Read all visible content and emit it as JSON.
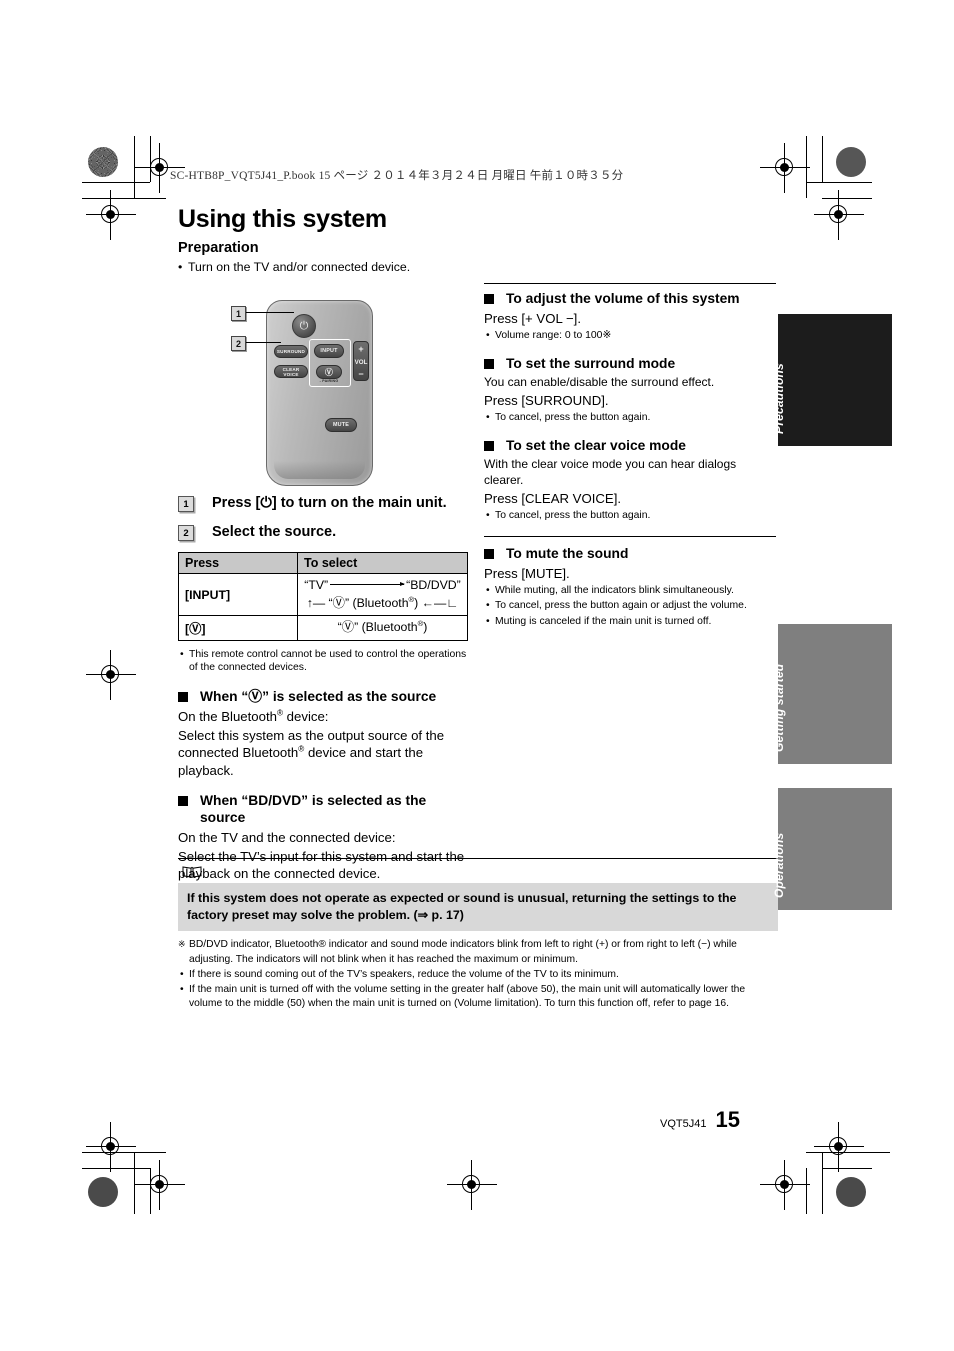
{
  "header": {
    "book_line": "SC-HTB8P_VQT5J41_P.book   15 ページ   ２０１４年３月２４日   月曜日   午前１０時３５分"
  },
  "page": {
    "title": "Using this system",
    "subtitle": "Preparation",
    "prep_bullet": "Turn on the TV and/or connected device."
  },
  "remote": {
    "callout_1": "1",
    "callout_2": "2",
    "buttons": {
      "power": "power-symbol",
      "surround": "SURROUND",
      "clear_voice": "CLEAR VOICE",
      "input": "INPUT",
      "bluetooth": "bluetooth-symbol",
      "pairing": "- PAIRING",
      "vol_plus": "+",
      "vol_label": "VOL",
      "vol_minus": "−",
      "mute": "MUTE"
    }
  },
  "steps": [
    {
      "num": "1",
      "text": "Press [⏻] to turn on the main unit."
    },
    {
      "num": "2",
      "text": "Select the source."
    }
  ],
  "source_table": {
    "headers": [
      "Press",
      "To select"
    ],
    "rows": [
      {
        "press": "[INPUT]",
        "select_line1": "“TV” ⟶ “BD/DVD”",
        "select_line2": "↑— “ Ⓑ ” (Bluetooth®) ←—┘"
      },
      {
        "press": "[ Ⓑ ]",
        "select_line1": "“ Ⓑ ” (Bluetooth®)",
        "select_line2": ""
      }
    ]
  },
  "left_column": {
    "remote_note": "This remote control cannot be used to control the operations of the connected devices.",
    "bt_section": {
      "heading_pre": "When “",
      "heading_post": "” is selected as the source",
      "line1": "On the Bluetooth® device:",
      "line2": "Select this system as the output source of the connected Bluetooth® device and start the playback."
    },
    "bd_section": {
      "heading": "When “BD/DVD” is selected as the source",
      "line1": "On the TV and the connected device:",
      "line2": "Select the TV’s input for this system and start the playback on the connected device."
    }
  },
  "right_column": {
    "volume": {
      "heading": "To adjust the volume of this system",
      "press": "Press [+ VOL −].",
      "note": "Volume range: 0 to 100※"
    },
    "surround": {
      "heading": "To set the surround mode",
      "desc": "You can enable/disable the surround effect.",
      "press": "Press [SURROUND].",
      "note": "To cancel, press the button again."
    },
    "clear_voice": {
      "heading": "To set the clear voice mode",
      "desc": "With the clear voice mode you can hear dialogs clearer.",
      "press": "Press [CLEAR VOICE].",
      "note": "To cancel, press the button again."
    },
    "mute": {
      "heading": "To mute the sound",
      "press": "Press [MUTE].",
      "notes": [
        "While muting, all the indicators blink simultaneously.",
        "To cancel, press the button again or adjust the volume.",
        "Muting is canceled if the main unit is turned off."
      ]
    }
  },
  "note_block": {
    "icon": "open-book-icon",
    "highlight": "If this system does not operate as expected or sound is unusual, returning the settings to the factory preset may solve the problem. (⇒ p. 17)",
    "ref_note": "BD/DVD indicator, Bluetooth® indicator and sound mode indicators blink from left to right (+) or from right to left (−) while adjusting. The indicators will not blink when it has reached the maximum or minimum.",
    "bullets": [
      "If there is sound coming out of the TV’s speakers, reduce the volume of the TV to its minimum.",
      "If the main unit is turned off with the volume setting in the greater half (above 50), the main unit will automatically lower the volume to the middle (50) when the main unit is turned on (Volume limitation). To turn this function off, refer to page 16."
    ]
  },
  "side_tabs": [
    {
      "label": "Precautions",
      "color": "#1c1c1c"
    },
    {
      "label": "Getting started",
      "color": "#7f7f7f"
    },
    {
      "label": "Operations",
      "color": "#7f7f7f"
    }
  ],
  "footer": {
    "code": "VQT5J41",
    "page_number": "15"
  }
}
